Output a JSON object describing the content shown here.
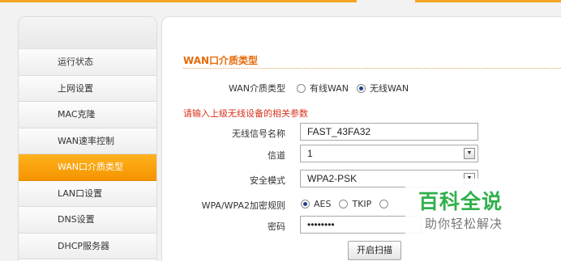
{
  "sidebar": {
    "items": [
      {
        "label": "运行状态"
      },
      {
        "label": "上网设置"
      },
      {
        "label": "MAC克隆"
      },
      {
        "label": "WAN速率控制"
      },
      {
        "label": "WAN口介质类型",
        "active": true
      },
      {
        "label": "LAN口设置"
      },
      {
        "label": "DNS设置"
      },
      {
        "label": "DHCP服务器"
      }
    ]
  },
  "main": {
    "section_title": "WAN口介质类型",
    "wan_type": {
      "label": "WAN介质类型",
      "options": [
        "有线WAN",
        "无线WAN"
      ],
      "selected": "无线WAN"
    },
    "warning": "请输入上级无线设备的相关参数",
    "ssid": {
      "label": "无线信号名称",
      "value": "FAST_43FA32"
    },
    "channel": {
      "label": "信道",
      "value": "1"
    },
    "security": {
      "label": "安全模式",
      "value": "WPA2-PSK"
    },
    "encryption": {
      "label": "WPA/WPA2加密规则",
      "options": [
        "AES",
        "TKIP"
      ],
      "selected": "AES"
    },
    "password": {
      "label": "密码",
      "value": "••••••••"
    },
    "scan_button": "开启扫描"
  },
  "watermark": {
    "title": "百科全说",
    "subtitle": "助你轻松解决"
  },
  "colors": {
    "accent": "#f49400",
    "section_title": "#e56b0a",
    "warning": "#d9301a",
    "watermark": "#30b04b"
  }
}
